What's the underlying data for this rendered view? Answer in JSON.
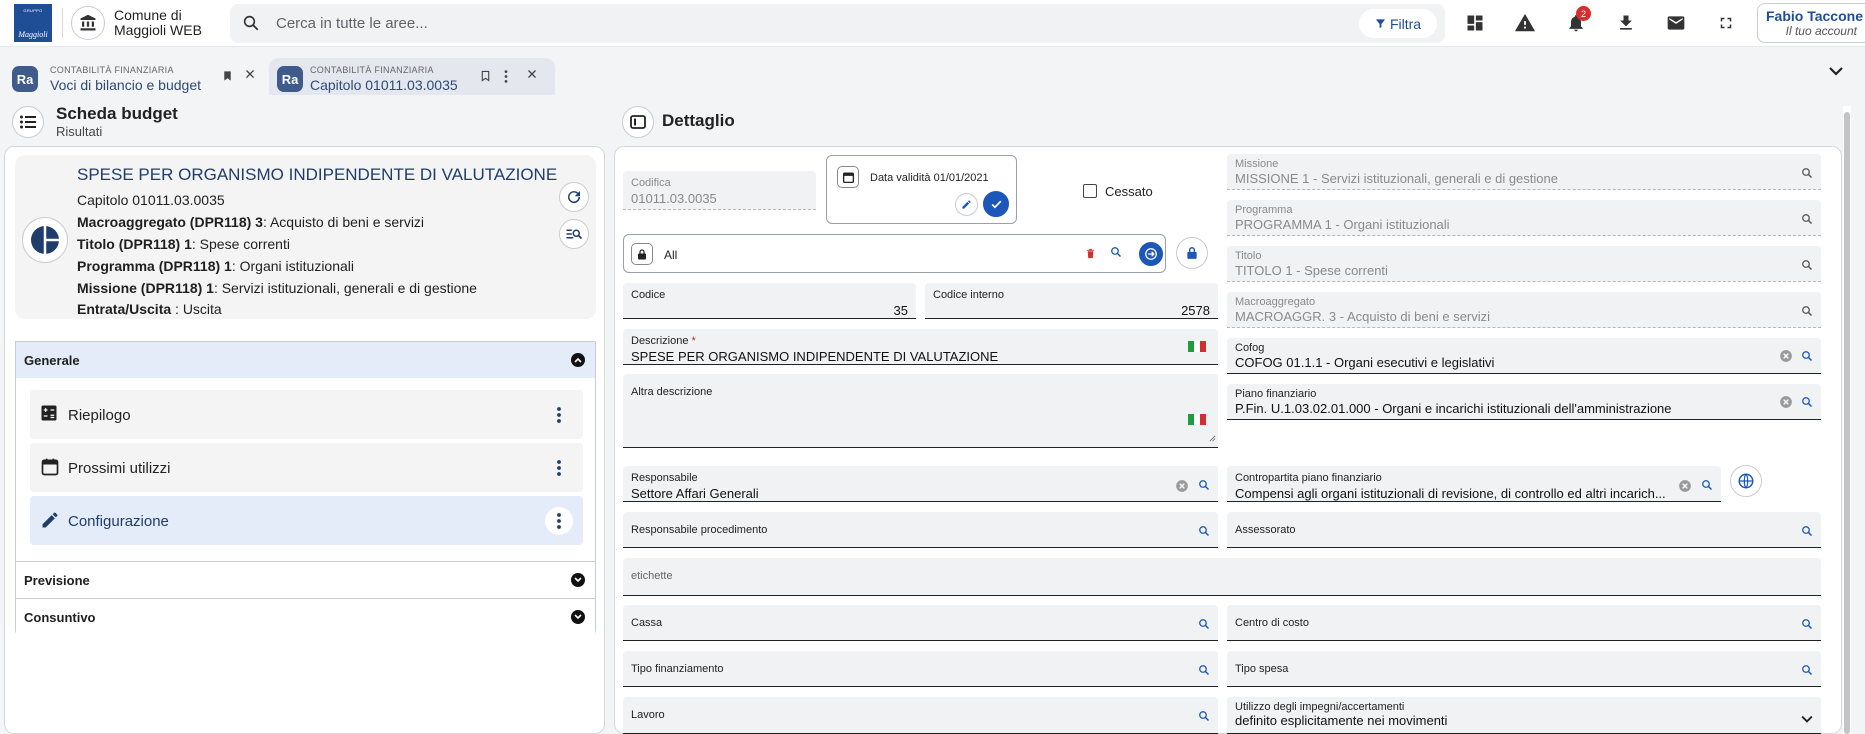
{
  "header": {
    "logo_top": "GRUPPO",
    "logo_brand": "Maggioli",
    "ente_line1": "Comune di",
    "ente_line2": "Maggioli WEB",
    "search_placeholder": "Cerca in tutte le aree...",
    "filter_label": "Filtra",
    "notifications_count": "2",
    "user_name": "Fabio Taccone",
    "user_subtitle": "Il tuo account"
  },
  "tabs": [
    {
      "category": "CONTABILITÀ FINANZIARIA",
      "title": "Voci di bilancio e budget",
      "icon_text": "Ra"
    },
    {
      "category": "CONTABILITÀ FINANZIARIA",
      "title": "Capitolo 01011.03.0035",
      "icon_text": "Ra"
    }
  ],
  "left": {
    "title": "Scheda budget",
    "subtitle": "Risultati",
    "card": {
      "title": "SPESE PER ORGANISMO INDIPENDENTE DI VALUTAZIONE",
      "capitolo": "Capitolo 01011.03.0035",
      "rows": [
        {
          "key": "Macroaggregato (DPR118) 3",
          "value": ": Acquisto di beni e servizi"
        },
        {
          "key": "Titolo (DPR118) 1",
          "value": ": Spese correnti"
        },
        {
          "key": "Programma (DPR118) 1",
          "value": ": Organi istituzionali"
        },
        {
          "key": "Missione (DPR118) 1",
          "value": ": Servizi istituzionali, generali e di gestione"
        },
        {
          "key": "Entrata/Uscita",
          "value": " : Uscita"
        }
      ]
    },
    "sections": {
      "generale": "Generale",
      "previsione": "Previsione",
      "consuntivo": "Consuntivo"
    },
    "items": [
      "Riepilogo",
      "Prossimi utilizzi",
      "Configurazione"
    ]
  },
  "detail": {
    "title": "Dettaglio",
    "codifica_label": "Codifica",
    "codifica_value": "01011.03.0035",
    "data_validita": "Data validità 01/01/2021",
    "cessato_label": "Cessato",
    "all_label": "All",
    "codice_label": "Codice",
    "codice_value": "35",
    "codice_interno_label": "Codice interno",
    "codice_interno_value": "2578",
    "descrizione_label": "Descrizione",
    "descrizione_value": "SPESE PER ORGANISMO INDIPENDENTE DI VALUTAZIONE",
    "altra_descrizione_label": "Altra descrizione",
    "responsabile_label": "Responsabile",
    "responsabile_value": "Settore Affari Generali",
    "responsabile_procedimento_label": "Responsabile procedimento",
    "etichette_label": "etichette",
    "cassa_label": "Cassa",
    "tipo_finanziamento_label": "Tipo finanziamento",
    "lavoro_label": "Lavoro",
    "missione_label": "Missione",
    "missione_value": "MISSIONE 1 - Servizi istituzionali, generali e di gestione",
    "programma_label": "Programma",
    "programma_value": "PROGRAMMA 1 - Organi istituzionali",
    "titolo_label": "Titolo",
    "titolo_value": "TITOLO 1 - Spese correnti",
    "macroaggregato_label": "Macroaggregato",
    "macroaggregato_value": "MACROAGGR. 3 - Acquisto di beni e servizi",
    "cofog_label": "Cofog",
    "cofog_value": "COFOG 01.1.1 - Organi esecutivi e legislativi",
    "piano_label": "Piano finanziario",
    "piano_value": "P.Fin. U.1.03.02.01.000 - Organi e incarichi istituzionali dell'amministrazione",
    "contropartita_label": "Contropartita piano finanziario",
    "contropartita_value": "Compensi agli organi istituzionali di revisione, di controllo ed altri incarich...",
    "assessorato_label": "Assessorato",
    "centro_costo_label": "Centro di costo",
    "tipo_spesa_label": "Tipo spesa",
    "utilizzo_label": "Utilizzo degli impegni/accertamenti",
    "utilizzo_value": "definito esplicitamente nei movimenti"
  },
  "colors": {
    "brand": "#1f4e96",
    "accent_button": "#1b56b8",
    "selected_bg": "#e3ecf8"
  }
}
